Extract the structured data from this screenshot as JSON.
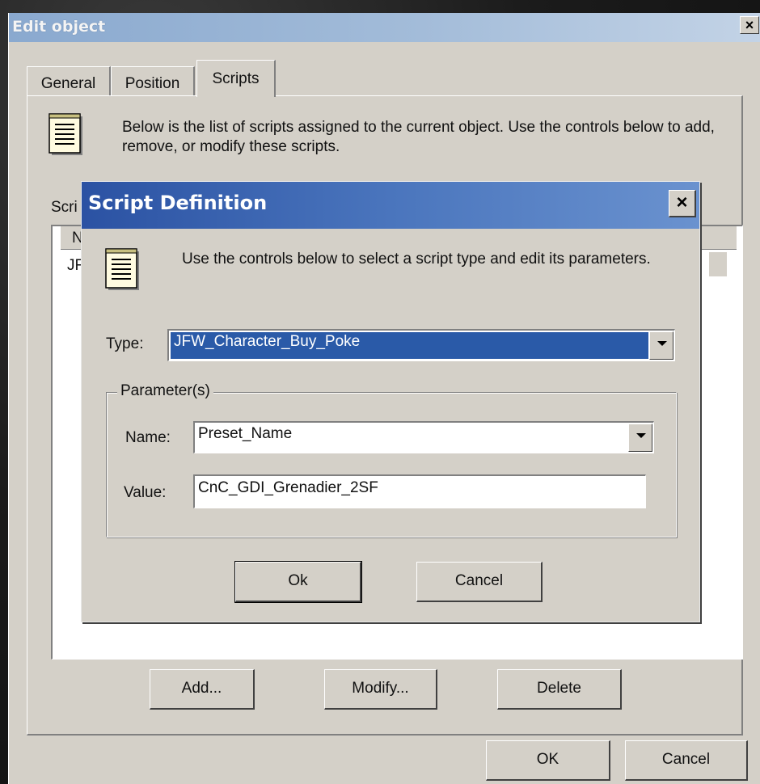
{
  "outer_window": {
    "title": "Edit object",
    "close_glyph": "×",
    "tabs": [
      {
        "label": "General",
        "active": false
      },
      {
        "label": "Position",
        "active": false
      },
      {
        "label": "Scripts",
        "active": true
      }
    ],
    "description": "Below is the list of scripts assigned to the current object.  Use the controls below to add, remove, or modify these scripts.",
    "scripts_label": "Scri",
    "list_header": "N",
    "list_rows": [
      "JF"
    ],
    "buttons": {
      "add": "Add...",
      "modify": "Modify...",
      "delete": "Delete",
      "ok": "OK",
      "cancel": "Cancel"
    }
  },
  "dialog": {
    "title": "Script Definition",
    "close_glyph": "×",
    "description": "Use the controls below to select a script type and edit its parameters.",
    "type_label": "Type:",
    "type_value": "JFW_Character_Buy_Poke",
    "parameters_group_label": "Parameter(s)",
    "name_label": "Name:",
    "name_value": "Preset_Name",
    "value_label": "Value:",
    "value_value": "CnC_GDI_Grenadier_2SF",
    "ok_label": "Ok",
    "cancel_label": "Cancel"
  },
  "colors": {
    "dialog_face": "#d4d0c8",
    "inner_title_blue": "#2b52a3",
    "selection_blue": "#2a5aa8",
    "outer_title_blue": "#8aa9cf"
  },
  "icons": [
    "notepad-icon",
    "close-icon",
    "dropdown-arrow-icon"
  ]
}
